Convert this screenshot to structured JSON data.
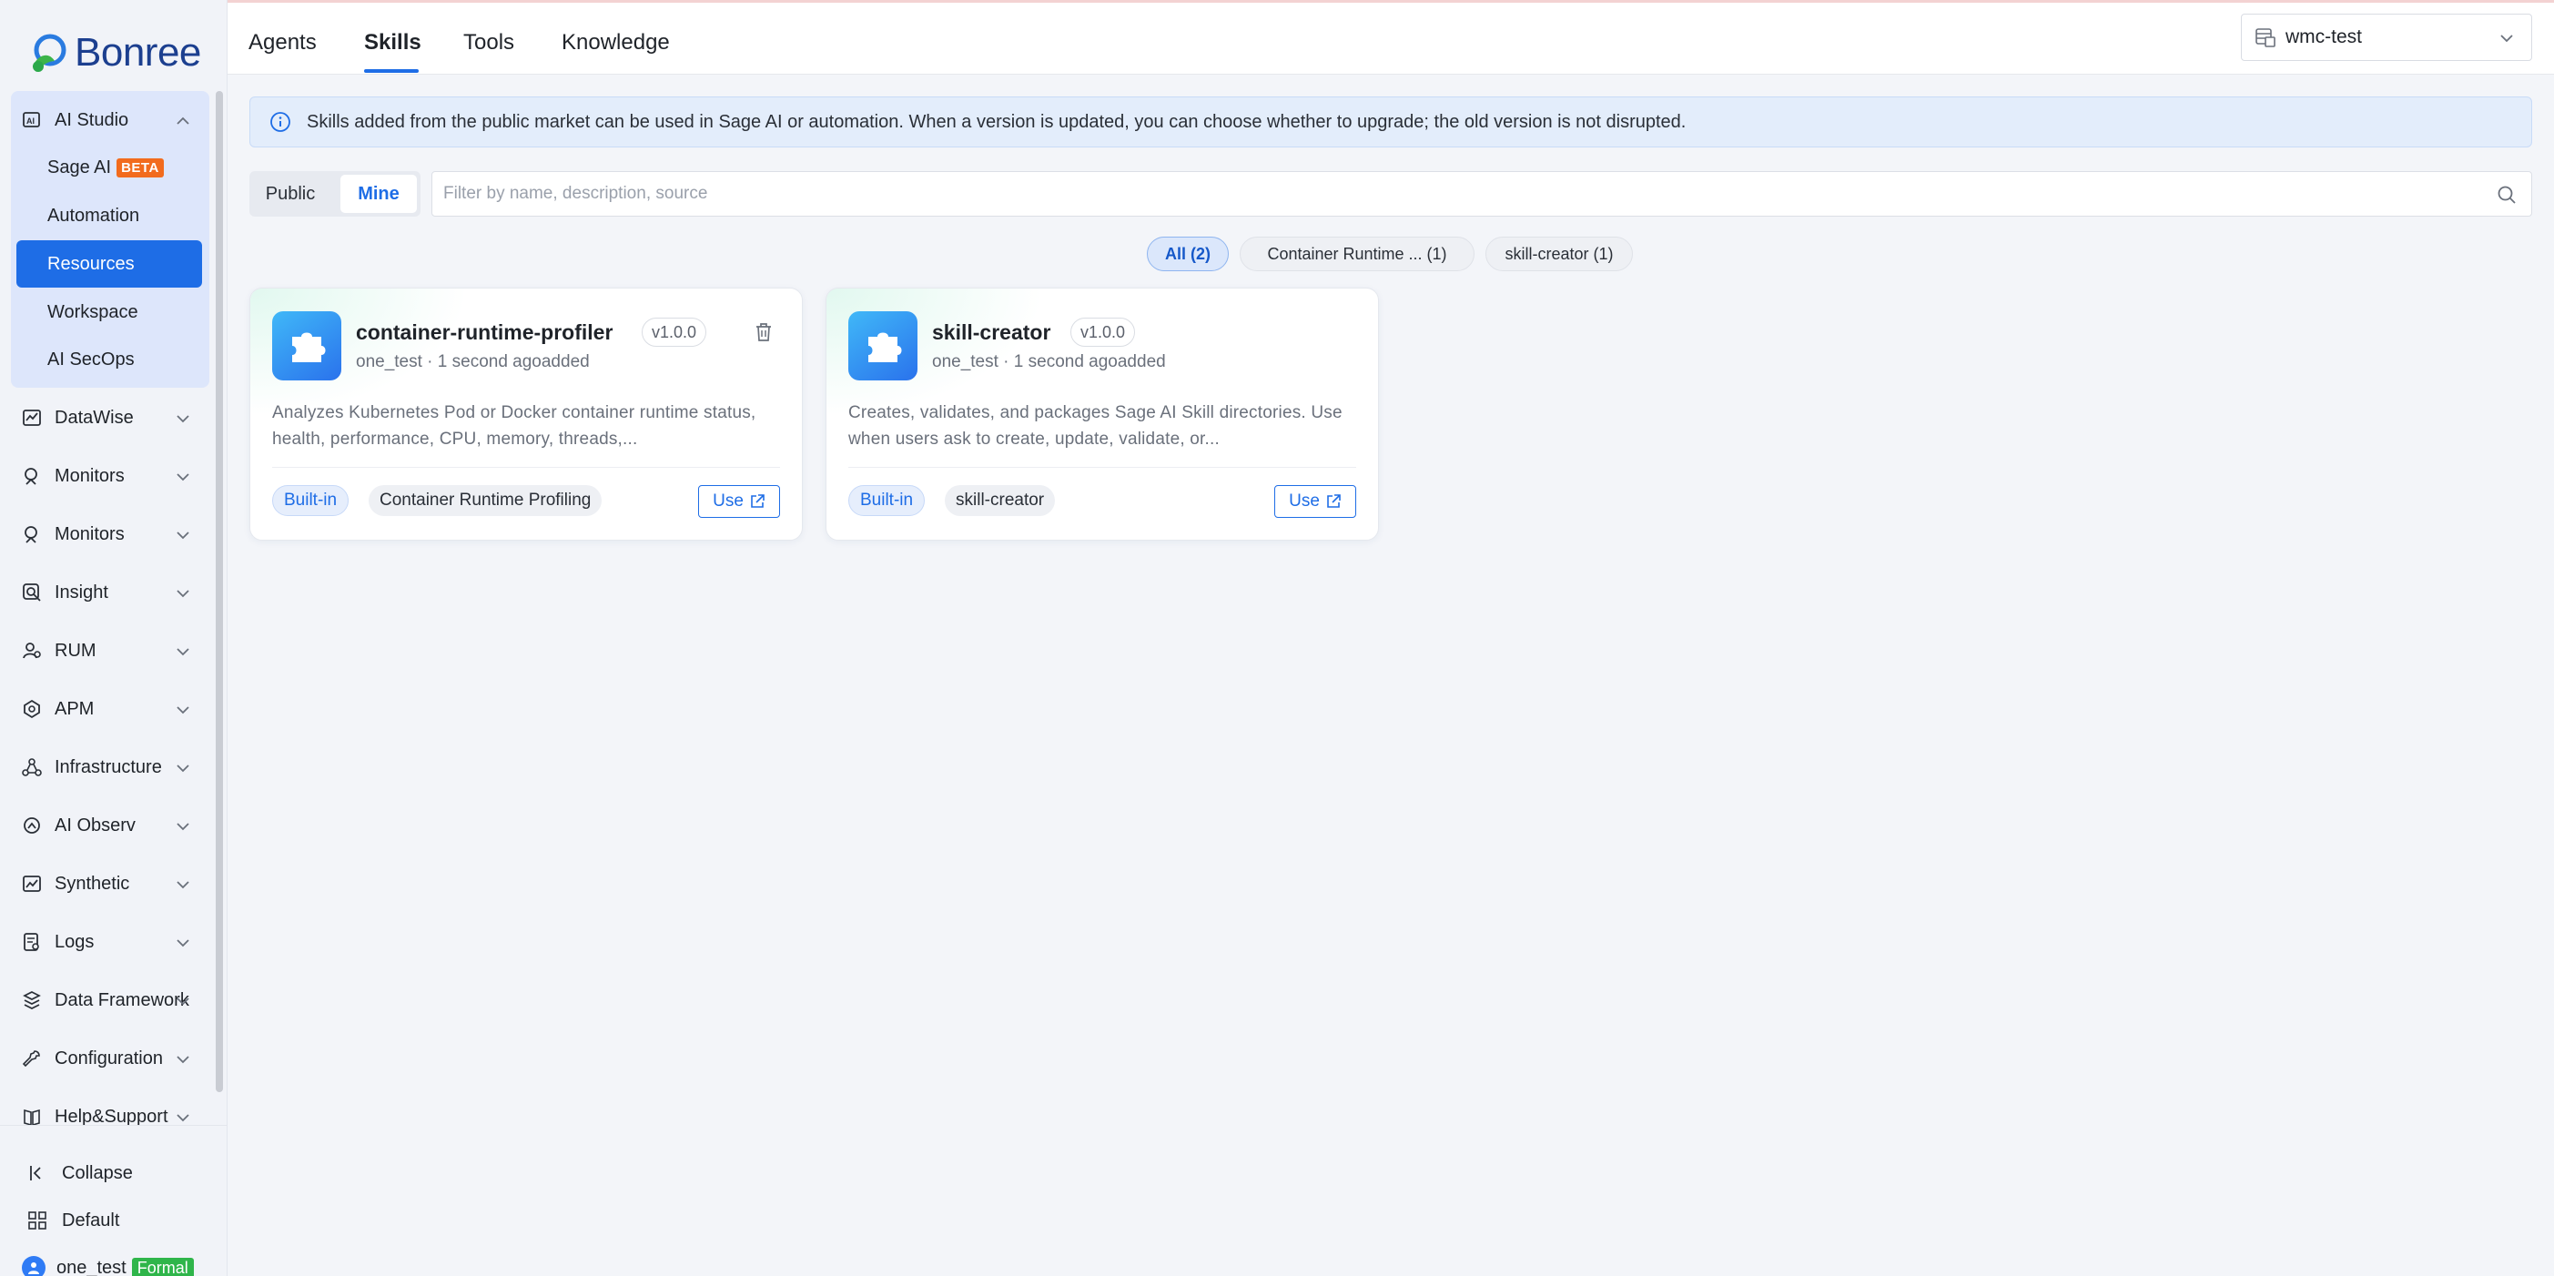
{
  "brand": {
    "name": "Bonree"
  },
  "sidebar": {
    "group": {
      "label": "AI Studio",
      "items": [
        {
          "label": "Sage AI",
          "badge": "BETA"
        },
        {
          "label": "Automation"
        },
        {
          "label": "Resources",
          "active": true
        },
        {
          "label": "Workspace"
        },
        {
          "label": "AI SecOps"
        }
      ]
    },
    "sections": [
      {
        "label": "DataWise",
        "icon": "chart-icon"
      },
      {
        "label": "Monitors",
        "icon": "monitor-icon"
      },
      {
        "label": "Monitors",
        "icon": "monitor-icon"
      },
      {
        "label": "Insight",
        "icon": "insight-icon"
      },
      {
        "label": "RUM",
        "icon": "user-icon"
      },
      {
        "label": "APM",
        "icon": "apm-icon"
      },
      {
        "label": "Infrastructure",
        "icon": "infrastructure-icon"
      },
      {
        "label": "AI Observ",
        "icon": "ai-observ-icon"
      },
      {
        "label": "Synthetic",
        "icon": "synthetic-icon"
      },
      {
        "label": "Logs",
        "icon": "logs-icon"
      },
      {
        "label": "Data Framework",
        "icon": "data-framework-icon"
      },
      {
        "label": "Configuration",
        "icon": "wrench-icon"
      },
      {
        "label": "Help&Support",
        "icon": "book-icon"
      }
    ],
    "bottom": {
      "collapse": "Collapse",
      "theme": "Default",
      "user": "one_test",
      "user_badge": "Formal"
    }
  },
  "topbar": {
    "tabs": [
      "Agents",
      "Skills",
      "Tools",
      "Knowledge"
    ],
    "active_tab": "Skills",
    "workspace": "wmc-test"
  },
  "notice": "Skills added from the public market can be used in Sage AI or automation. When a version is updated, you can choose whether to upgrade; the old version is not disrupted.",
  "filter": {
    "segments": [
      "Public",
      "Mine"
    ],
    "active_segment": "Mine",
    "search_placeholder": "Filter by name, description, source",
    "chips": [
      "All (2)",
      "Container Runtime ...  (1)",
      "skill-creator (1)"
    ]
  },
  "cards": [
    {
      "title": "container-runtime-profiler",
      "version": "v1.0.0",
      "meta": "one_test · 1 second agoadded",
      "description": "Analyzes Kubernetes Pod or Docker container runtime status, health, performance, CPU, memory, threads,...",
      "tags": [
        "Built-in",
        "Container Runtime Profiling"
      ],
      "use_label": "Use"
    },
    {
      "title": "skill-creator",
      "version": "v1.0.0",
      "meta": "one_test · 1 second agoadded",
      "description": "Creates, validates, and packages Sage AI Skill directories. Use when users ask to create, update, validate, or...",
      "tags": [
        "Built-in",
        "skill-creator"
      ],
      "use_label": "Use"
    }
  ],
  "colors": {
    "accent": "#1e6de6",
    "beta_badge": "#f26b1d",
    "formal_badge": "#2fb54a",
    "notice_bg": "#e3edfb",
    "sidebar_group_bg": "#dde6fb"
  }
}
